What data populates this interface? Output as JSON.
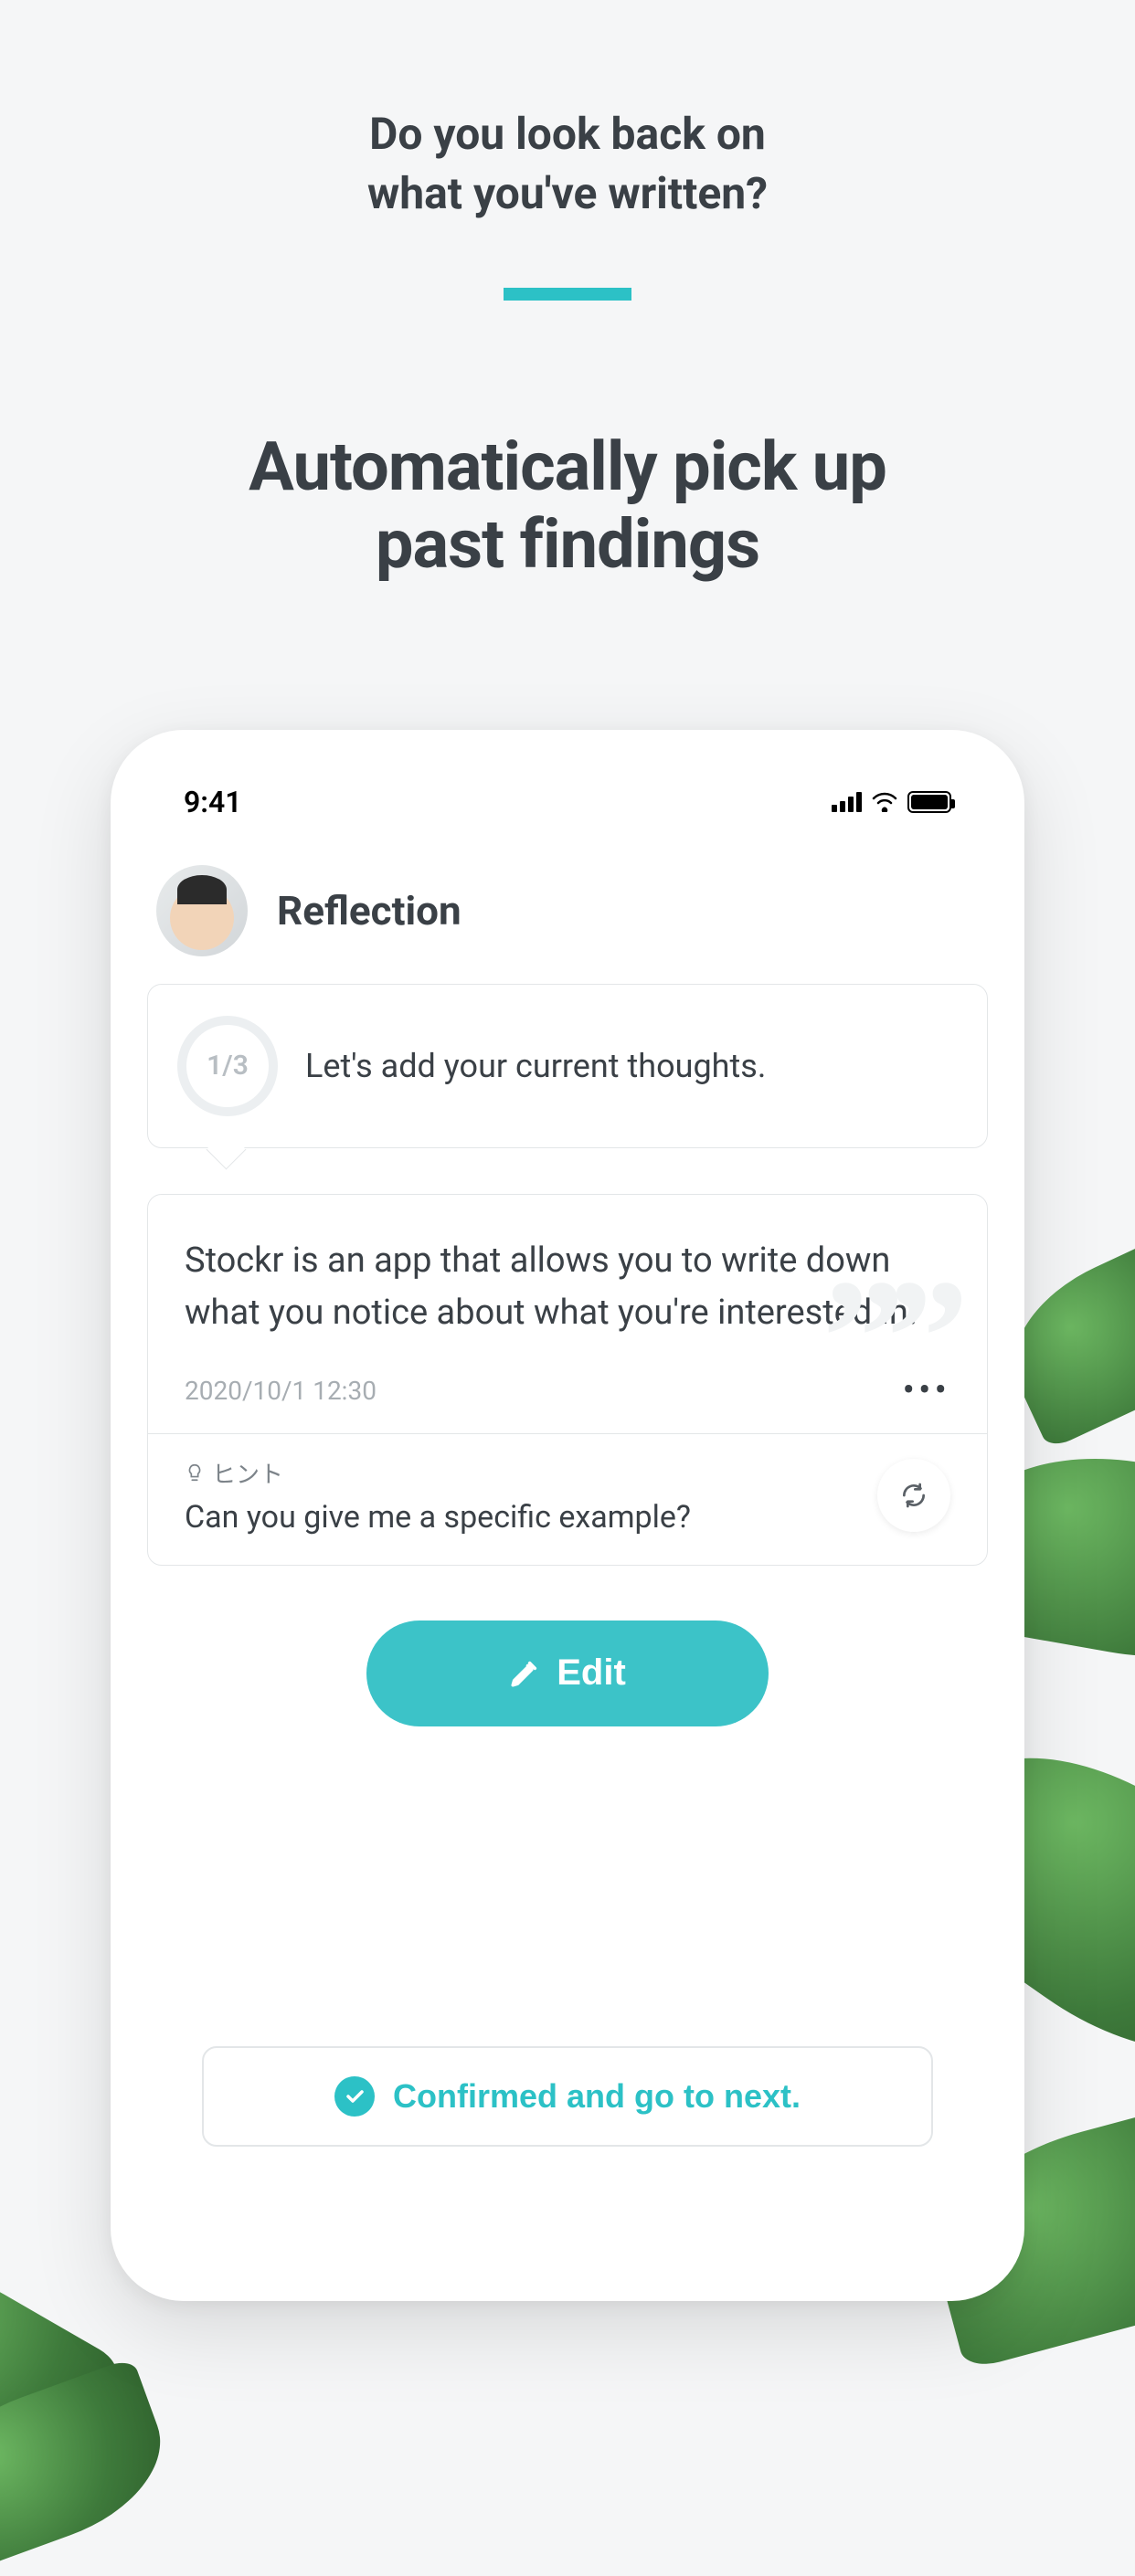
{
  "marketing": {
    "question_line1": "Do you look back on",
    "question_line2": "what you've written?",
    "headline_line1": "Automatically pick up",
    "headline_line2": "past findings"
  },
  "status_bar": {
    "time": "9:41"
  },
  "app": {
    "screen_title": "Reflection",
    "prompt": {
      "step": "1/3",
      "text": "Let's add your current thoughts."
    },
    "note": {
      "text": "Stockr is an app that allows you to write down what you notice about what you're interested in.",
      "timestamp": "2020/10/1 12:30"
    },
    "hint": {
      "label": "ヒント",
      "text": "Can you give me a specific example?"
    },
    "buttons": {
      "edit": "Edit",
      "confirm": "Confirmed and go to next."
    }
  },
  "colors": {
    "accent": "#2cc1c6"
  }
}
